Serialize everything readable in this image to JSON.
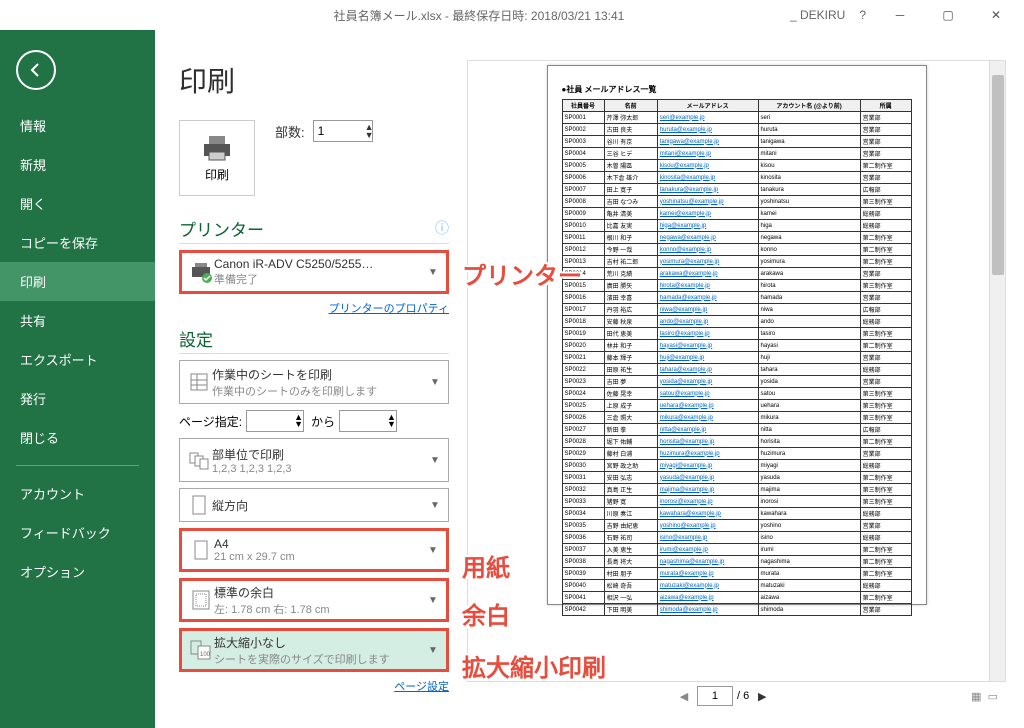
{
  "titlebar": {
    "title": "社員名簿メール.xlsx - 最終保存日時: 2018/03/21 13:41",
    "account": "_ DEKIRU",
    "help": "?"
  },
  "sidebar": {
    "items": [
      "情報",
      "新規",
      "開く",
      "コピーを保存",
      "印刷",
      "共有",
      "エクスポート",
      "発行",
      "閉じる",
      "アカウント",
      "フィードバック",
      "オプション"
    ],
    "selectedIndex": 4
  },
  "print": {
    "title": "印刷",
    "button": "印刷",
    "copies_label": "部数:",
    "copies_value": "1"
  },
  "printer": {
    "heading": "プリンター",
    "name": "Canon iR-ADV C5250/5255…",
    "status": "準備完了",
    "properties_link": "プリンターのプロパティ"
  },
  "settings": {
    "heading": "設定",
    "scope": {
      "title": "作業中のシートを印刷",
      "sub": "作業中のシートのみを印刷します"
    },
    "page_label": "ページ指定:",
    "page_from": "",
    "page_sep": "から",
    "page_to": "",
    "collate": {
      "title": "部単位で印刷",
      "sub": "1,2,3   1,2,3   1,2,3"
    },
    "orientation": {
      "title": "縦方向",
      "sub": ""
    },
    "paper": {
      "title": "A4",
      "sub": "21 cm x 29.7 cm"
    },
    "margin": {
      "title": "標準の余白",
      "sub": "左: 1.78 cm   右: 1.78 cm"
    },
    "scale": {
      "title": "拡大縮小なし",
      "sub": "シートを実際のサイズで印刷します"
    },
    "page_setup": "ページ設定"
  },
  "preview": {
    "sheet_title": "●社員 メールアドレス一覧",
    "headers": [
      "社員番号",
      "名前",
      "メールアドレス",
      "アカウント名 (@より前)",
      "所属"
    ],
    "current_page": "1",
    "total_pages": "/ 6"
  },
  "annotations": {
    "a1": "プリンター",
    "a2": "用紙",
    "a3": "余白",
    "a4": "拡大縮小印刷"
  },
  "chart_data": {
    "type": "table",
    "title": "●社員 メールアドレス一覧",
    "columns": [
      "社員番号",
      "名前",
      "メールアドレス",
      "アカウント名 (@より前)",
      "所属"
    ],
    "rows": [
      [
        "SP0001",
        "芹澤 弥太郎",
        "seri@example.jp",
        "seri",
        "営業部"
      ],
      [
        "SP0002",
        "古田 良夫",
        "huruta@example.jp",
        "huruta",
        "営業部"
      ],
      [
        "SP0003",
        "谷川 有京",
        "tanigawa@example.jp",
        "tanigawa",
        "営業部"
      ],
      [
        "SP0004",
        "三谷 ヒデ",
        "mitani@example.jp",
        "mitani",
        "営業部"
      ],
      [
        "SP0005",
        "木曽 陽區",
        "kisou@example.jp",
        "kisou",
        "第二制作室"
      ],
      [
        "SP0006",
        "木下倉 雄介",
        "kinosita@example.jp",
        "kinosita",
        "営業部"
      ],
      [
        "SP0007",
        "田上 寛子",
        "tanakura@example.jp",
        "tanakura",
        "広報部"
      ],
      [
        "SP0008",
        "吉田 なつみ",
        "yoshinatsu@example.jp",
        "yoshinatsu",
        "第三制作室"
      ],
      [
        "SP0009",
        "亀井 清美",
        "kamei@example.jp",
        "kamei",
        "総務部"
      ],
      [
        "SP0010",
        "比嘉 友実",
        "higa@example.jp",
        "higa",
        "総務部"
      ],
      [
        "SP0011",
        "根川 和子",
        "negawa@example.jp",
        "negawa",
        "第二制作室"
      ],
      [
        "SP0012",
        "今野 一哉",
        "konno@example.jp",
        "konno",
        "第二制作室"
      ],
      [
        "SP0013",
        "吉村 祐二郎",
        "yosimura@example.jp",
        "yosimura",
        "第二制作室"
      ],
      [
        "SP0014",
        "荒川 克績",
        "arakawa@example.jp",
        "arakawa",
        "営業部"
      ],
      [
        "SP0015",
        "廣田 勝矢",
        "hirota@example.jp",
        "hirota",
        "第三制作室"
      ],
      [
        "SP0016",
        "濱田 幸喜",
        "hamada@example.jp",
        "hamada",
        "営業部"
      ],
      [
        "SP0017",
        "丹羽 裕広",
        "niwa@example.jp",
        "niwa",
        "広報部"
      ],
      [
        "SP0018",
        "安藤 秋泉",
        "ando@example.jp",
        "ando",
        "総務部"
      ],
      [
        "SP0019",
        "田代 恵美",
        "tasiro@example.jp",
        "tasiro",
        "第三制作室"
      ],
      [
        "SP0020",
        "林井 和子",
        "hayasi@example.jp",
        "hayasi",
        "第二制作室"
      ],
      [
        "SP0021",
        "藤本 輝子",
        "huji@example.jp",
        "huji",
        "営業部"
      ],
      [
        "SP0022",
        "田原 祐生",
        "tahara@example.jp",
        "tahara",
        "総務部"
      ],
      [
        "SP0023",
        "吉田 夢",
        "yosida@example.jp",
        "yosida",
        "営業部"
      ],
      [
        "SP0024",
        "佐藤 晃幸",
        "satou@example.jp",
        "satou",
        "第三制作室"
      ],
      [
        "SP0025",
        "上原 成子",
        "uehara@example.jp",
        "uehara",
        "第三制作室"
      ],
      [
        "SP0026",
        "三倉 照大",
        "mikura@example.jp",
        "mikura",
        "第三制作室"
      ],
      [
        "SP0027",
        "新田 拳",
        "nitta@example.jp",
        "nitta",
        "広報部"
      ],
      [
        "SP0028",
        "堀下 佑輔",
        "horisita@example.jp",
        "horisita",
        "第二制作室"
      ],
      [
        "SP0029",
        "藤村 白浦",
        "huzimura@example.jp",
        "huzimura",
        "営業部"
      ],
      [
        "SP0030",
        "宮野 政之助",
        "miyagi@example.jp",
        "miyagi",
        "総務部"
      ],
      [
        "SP0031",
        "安田 弘志",
        "yasuda@example.jp",
        "yasuda",
        "第二制作室"
      ],
      [
        "SP0032",
        "真島 正生",
        "majima@example.jp",
        "majima",
        "第三制作室"
      ],
      [
        "SP0033",
        "猪野 寛",
        "inorosi@example.jp",
        "inorosi",
        "第三制作室"
      ],
      [
        "SP0034",
        "川原 奏江",
        "kawahara@example.jp",
        "kawahara",
        "総務部"
      ],
      [
        "SP0035",
        "吉野 由紀恵",
        "yoshino@example.jp",
        "yoshino",
        "営業部"
      ],
      [
        "SP0036",
        "石野 祐司",
        "isino@example.jp",
        "isino",
        "総務部"
      ],
      [
        "SP0037",
        "入美 恵生",
        "irumi@example.jp",
        "irumi",
        "第二制作室"
      ],
      [
        "SP0038",
        "長島 将大",
        "nagashima@example.jp",
        "nagashima",
        "第二制作室"
      ],
      [
        "SP0039",
        "村田 朋子",
        "murata@example.jp",
        "murata",
        "第二制作室"
      ],
      [
        "SP0040",
        "松崎 奇吾",
        "matuzaki@example.jp",
        "matuzaki",
        "総務部"
      ],
      [
        "SP0041",
        "相沢 一弘",
        "aizawa@example.jp",
        "aizawa",
        "第二制作室"
      ],
      [
        "SP0042",
        "下田 明美",
        "shimoda@example.jp",
        "shimoda",
        "営業部"
      ]
    ]
  }
}
